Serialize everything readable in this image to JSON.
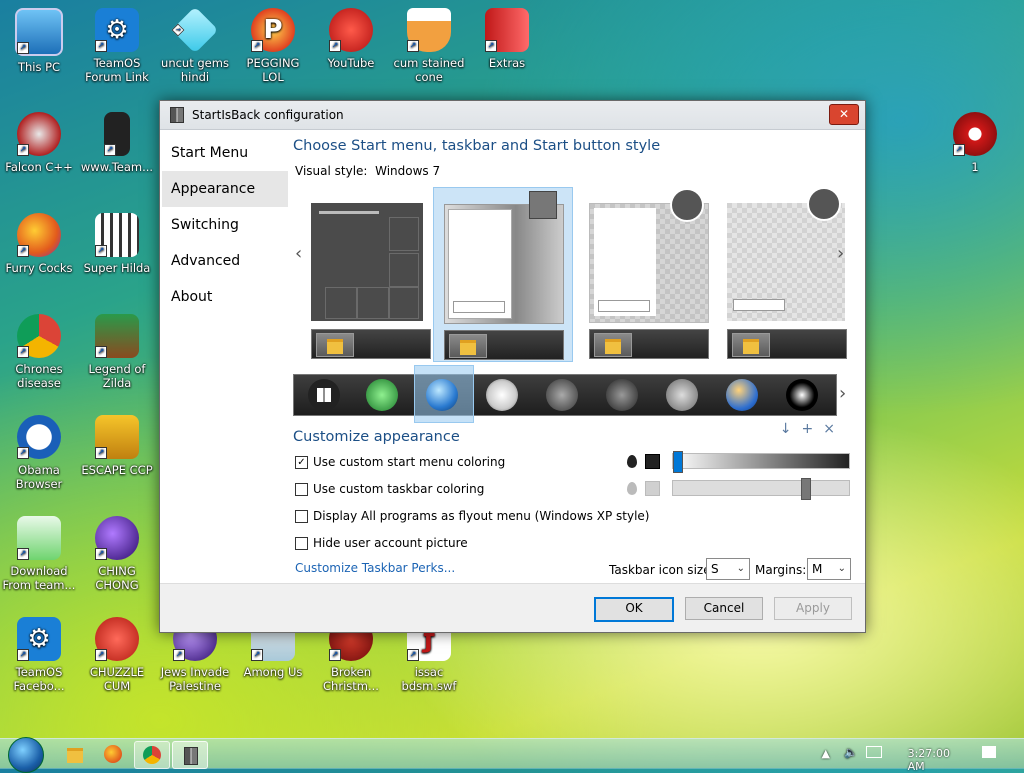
{
  "desktop": {
    "icons": [
      {
        "label": "This PC",
        "icon": "this-pc-icon"
      },
      {
        "label": "TeamOS Forum Link",
        "icon": "gear-icon"
      },
      {
        "label": "uncut gems hindi",
        "icon": "diamond-icon"
      },
      {
        "label": "PEGGING LOL",
        "icon": "p-logo-icon"
      },
      {
        "label": "YouTube",
        "icon": "angry-bird-icon"
      },
      {
        "label": "cum stained cone",
        "icon": "cone-icon"
      },
      {
        "label": "Extras",
        "icon": "extras-icon"
      },
      {
        "label": "Falcon C++",
        "icon": "falcon-icon"
      },
      {
        "label": "www.Team...",
        "icon": "device-icon"
      },
      {
        "label": "Furry Cocks",
        "icon": "firefox-icon"
      },
      {
        "label": "Super Hilda",
        "icon": "pixel-dog-icon"
      },
      {
        "label": "Chrones disease",
        "icon": "chrome-icon"
      },
      {
        "label": "Legend of Zilda",
        "icon": "zelda-icon"
      },
      {
        "label": "Obama Browser",
        "icon": "obama-logo-icon"
      },
      {
        "label": "ESCAPE CCP",
        "icon": "mahjong-icon"
      },
      {
        "label": "Download From team...",
        "icon": "notepad-icon"
      },
      {
        "label": "CHING CHONG",
        "icon": "bomb-icon"
      },
      {
        "label": "TeamOS Facebo...",
        "icon": "gear-icon"
      },
      {
        "label": "CHUZZLE CUM",
        "icon": "chuzzle-icon"
      },
      {
        "label": "Jews Invade Palestine",
        "icon": "ball-icon"
      },
      {
        "label": "Among Us",
        "icon": "among-us-icon"
      },
      {
        "label": "Broken Christm...",
        "icon": "ornament-icon"
      },
      {
        "label": "issac bdsm.swf",
        "icon": "flash-icon"
      },
      {
        "label": "1",
        "icon": "red-ball-icon"
      }
    ]
  },
  "window": {
    "title": "StartIsBack configuration",
    "close_glyph": "✕",
    "nav": [
      "Start Menu",
      "Appearance",
      "Switching",
      "Advanced",
      "About"
    ],
    "heading": "Choose Start menu, taskbar and Start button style",
    "visual_style_label": "Visual style:",
    "visual_style_value": "Windows 7",
    "customize_heading": "Customize appearance",
    "options": [
      {
        "label": "Use custom start menu coloring",
        "checked": true
      },
      {
        "label": "Use custom taskbar coloring",
        "checked": false
      },
      {
        "label": "Display All programs as flyout menu (Windows XP style)",
        "checked": false
      },
      {
        "label": "Hide user account picture",
        "checked": false
      }
    ],
    "sliders": [
      {
        "swatch": "#222222",
        "value": 0.02
      },
      {
        "swatch": "#d0d0d0",
        "value": 0.75
      }
    ],
    "link": "Customize Taskbar Perks...",
    "icon_size_label": "Taskbar icon size:",
    "icon_size_value": "S",
    "margins_label": "Margins:",
    "margins_value": "M",
    "buttons": {
      "ok": "OK",
      "cancel": "Cancel",
      "apply": "Apply"
    }
  },
  "taskbar": {
    "time": "3:27:00 AM"
  },
  "colors": {
    "heading": "#1c4f86",
    "selection": "#cce4f7",
    "accent": "#0078d7"
  }
}
